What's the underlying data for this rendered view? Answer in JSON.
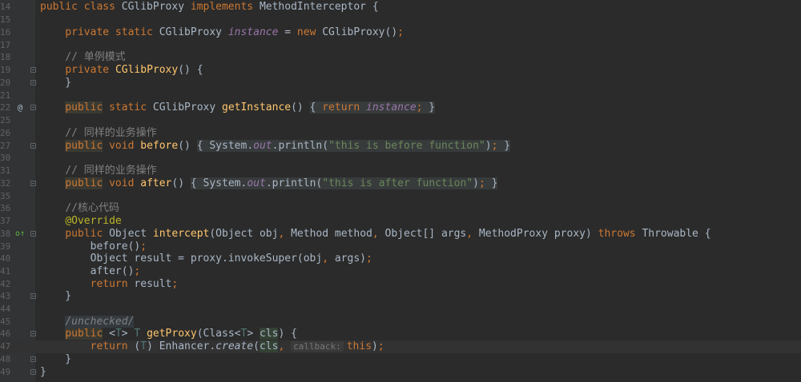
{
  "editor": {
    "lines": [
      {
        "n": "14",
        "text": "public class CGlibProxy implements MethodInterceptor {"
      },
      {
        "n": "15",
        "text": ""
      },
      {
        "n": "16",
        "text": "private static CGlibProxy instance = new CGlibProxy();"
      },
      {
        "n": "17",
        "text": ""
      },
      {
        "n": "18",
        "text": "// 单例模式"
      },
      {
        "n": "19",
        "text": "private CGlibProxy() {"
      },
      {
        "n": "20",
        "text": "}"
      },
      {
        "n": "21",
        "text": ""
      },
      {
        "n": "22",
        "text": "public static CGlibProxy getInstance() { return instance; }"
      },
      {
        "n": "25",
        "text": ""
      },
      {
        "n": "26",
        "text": "// 同样的业务操作"
      },
      {
        "n": "27",
        "text": "public void before() { System.out.println(\"this is before function\"); }"
      },
      {
        "n": "30",
        "text": ""
      },
      {
        "n": "31",
        "text": "// 同样的业务操作"
      },
      {
        "n": "32",
        "text": "public void after() { System.out.println(\"this is after function\"); }"
      },
      {
        "n": "35",
        "text": ""
      },
      {
        "n": "36",
        "text": "//核心代码"
      },
      {
        "n": "37",
        "text": "@Override"
      },
      {
        "n": "38",
        "text": "public Object intercept(Object obj, Method method, Object[] args, MethodProxy proxy) throws Throwable {"
      },
      {
        "n": "39",
        "text": "before();"
      },
      {
        "n": "40",
        "text": "Object result = proxy.invokeSuper(obj, args);"
      },
      {
        "n": "41",
        "text": "after();"
      },
      {
        "n": "42",
        "text": "return result;"
      },
      {
        "n": "43",
        "text": "}"
      },
      {
        "n": "44",
        "text": ""
      },
      {
        "n": "45",
        "text": "/unchecked/"
      },
      {
        "n": "46",
        "text": "public <T> T getProxy(Class<T> cls) {"
      },
      {
        "n": "47",
        "text": "return (T) Enhancer.create(cls, callback: this);"
      },
      {
        "n": "48",
        "text": "}"
      },
      {
        "n": "49",
        "text": "}"
      }
    ],
    "gutter": {
      "at_marker": "@",
      "override_marker": "o↑"
    },
    "parameter_hint": "callback:"
  },
  "colors": {
    "background": "#2b2b2b",
    "gutter": "#313335",
    "keyword": "#cc7832",
    "method": "#ffc66d",
    "field": "#9876aa",
    "string": "#6a8759",
    "comment": "#808080",
    "annotation": "#bbb529",
    "text": "#a9b7c6"
  }
}
